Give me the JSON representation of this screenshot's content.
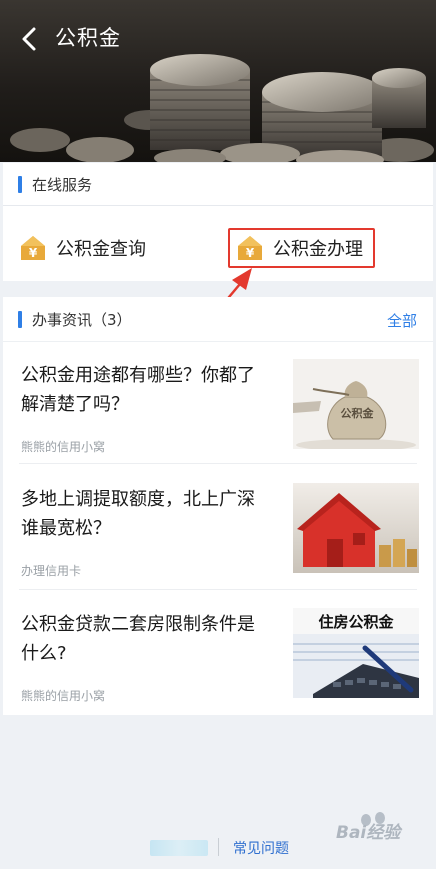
{
  "header": {
    "title": "公积金",
    "back_icon": "chevron-left-icon"
  },
  "online_services": {
    "title": "在线服务",
    "items": [
      {
        "label": "公积金查询",
        "icon": "yuan-house-icon"
      },
      {
        "label": "公积金办理",
        "icon": "yuan-house-icon"
      }
    ]
  },
  "news": {
    "title": "办事资讯（3）",
    "all_label": "全部",
    "items": [
      {
        "title": "公积金用途都有哪些？你都了解清楚了吗？",
        "source": "熊熊的信用小窝",
        "thumb_text": "公积金"
      },
      {
        "title": "多地上调提取额度，北上广深谁最宽松？",
        "source": "办理信用卡"
      },
      {
        "title": "公积金贷款二套房限制条件是什么?",
        "source": "熊熊的信用小窝",
        "thumb_text": "住房公积金"
      }
    ]
  },
  "footer": {
    "faq_label": "常见问题"
  },
  "watermark": {
    "text": "Bai经验"
  },
  "colors": {
    "accent": "#2f7fe6",
    "highlight": "#e3392e",
    "icon_gold": "#e8a93a"
  }
}
